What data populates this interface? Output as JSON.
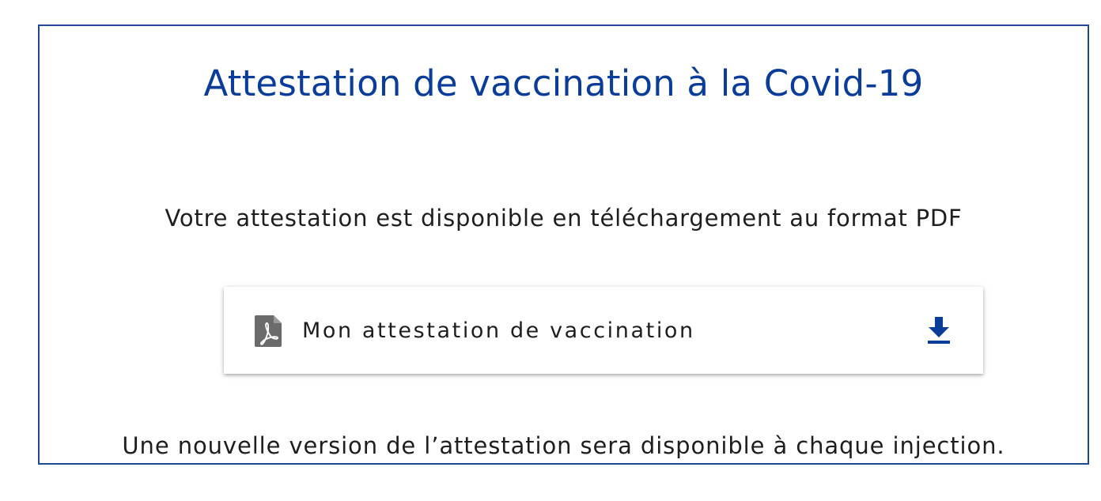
{
  "page": {
    "title": "Attestation de vaccination à la Covid-19",
    "subtitle": "Votre attestation est disponible en téléchargement au format PDF",
    "note": "Une nouvelle version de l’attestation sera disponible à chaque injection."
  },
  "document": {
    "label": "Mon attestation de vaccination",
    "file_icon": "pdf-file-icon",
    "action_icon": "download-icon"
  },
  "colors": {
    "accent": "#0a3d9a",
    "border": "#1f4a8f",
    "text": "#1e1e1e",
    "icon_gray": "#6b6b6b"
  }
}
